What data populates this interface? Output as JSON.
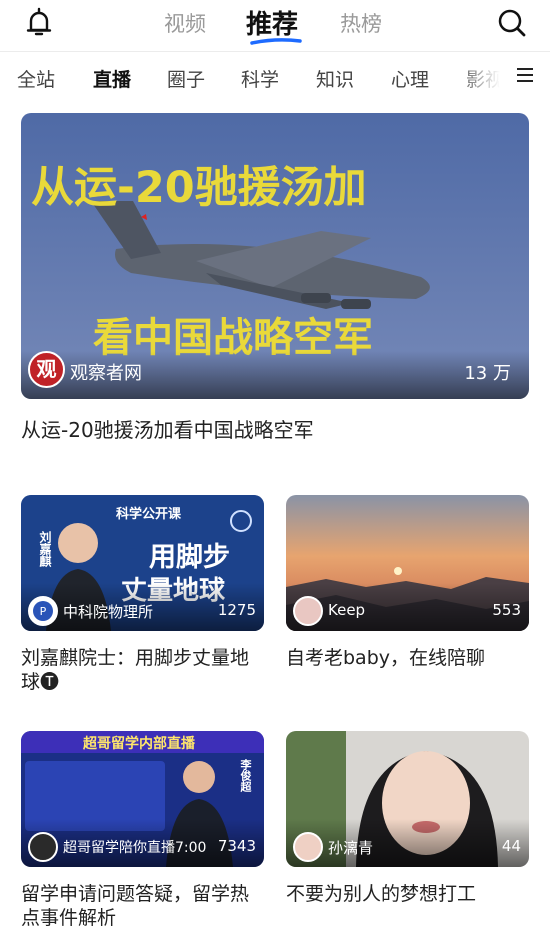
{
  "header": {
    "tabs": [
      "视频",
      "推荐",
      "热榜"
    ],
    "active_tab": "推荐",
    "accent": "#1e6bff"
  },
  "categories": [
    "全站",
    "直播",
    "圈子",
    "科学",
    "知识",
    "心理",
    "影视"
  ],
  "active_category": "直播",
  "featured": {
    "thumb_title_line1": "从运-20驰援汤加",
    "thumb_title_line2": "看中国战略空军",
    "author": "观察者网",
    "avatar_char": "观",
    "views": "13 万",
    "title": "从运-20驰援汤加看中国战略空军"
  },
  "cards": [
    {
      "author": "中科院物理所",
      "views": "1275",
      "title_line1": "刘嘉麒院士：用脚步丈量地",
      "title_line2": "球🅣",
      "thumb_tag": "科学公开课",
      "thumb_text_line1": "用脚步",
      "thumb_text_line2": "丈量地球",
      "thumb_name": "刘嘉麒"
    },
    {
      "author": "Keep",
      "views": "553",
      "title_line1": "自考老baby，在线陪聊",
      "title_line2": ""
    },
    {
      "author": "超哥留学陪你直播7:00",
      "views": "7343",
      "title_line1": "留学申请问题答疑，留学热",
      "title_line2": "点事件解析",
      "thumb_banner": "超哥留学内部直播",
      "thumb_name": "李俊超"
    },
    {
      "author": "孙漓青",
      "views": "44",
      "title_line1": "不要为别人的梦想打工",
      "title_line2": ""
    }
  ]
}
